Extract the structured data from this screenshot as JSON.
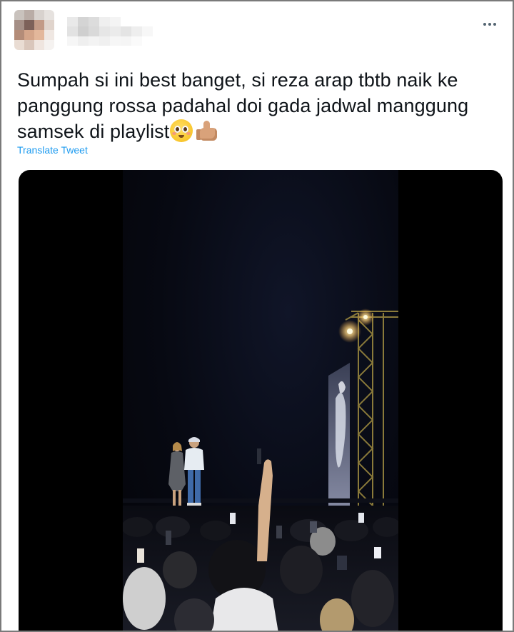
{
  "tweet": {
    "text": "Sumpah si ini best banget, si reza arap tbtb naik ke panggung rossa padahal doi gada jadwal manggung samsek di playlist",
    "emojis": [
      "pleading-face-icon",
      "thumbs-up-icon"
    ],
    "translate_label": "Translate Tweet"
  },
  "colors": {
    "link": "#1d9bf0",
    "text": "#0f1419",
    "media_bg": "#000000"
  }
}
